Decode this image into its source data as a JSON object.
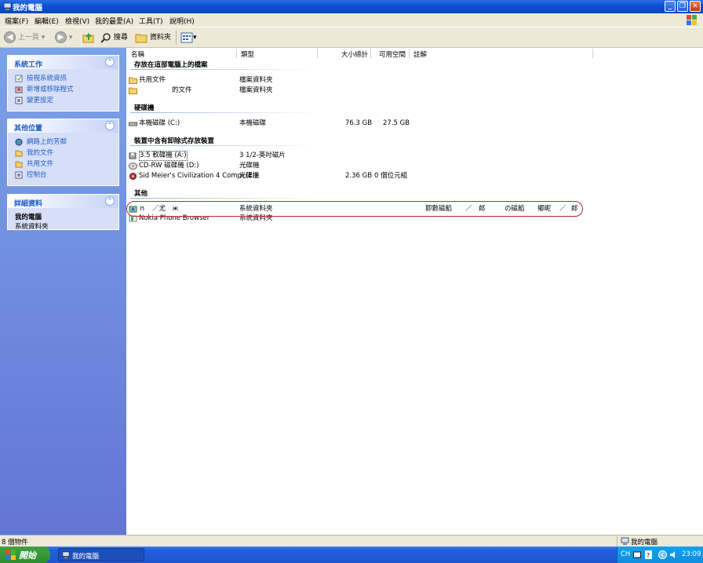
{
  "window": {
    "title": "我的電腦"
  },
  "menu": [
    "檔案(F)",
    "編輯(E)",
    "檢視(V)",
    "我的最愛(A)",
    "工具(T)",
    "說明(H)"
  ],
  "toolbar": {
    "back": "上一頁",
    "search": "搜尋",
    "folders": "資料夾"
  },
  "sidebar": {
    "system_tasks": {
      "title": "系統工作",
      "items": [
        "檢視系統資訊",
        "新增或移除程式",
        "變更設定"
      ]
    },
    "other_places": {
      "title": "其他位置",
      "items": [
        "網路上的芳鄰",
        "我的文件",
        "共用文件",
        "控制台"
      ]
    },
    "details": {
      "title": "詳細資料",
      "name": "我的電腦",
      "type": "系統資料夾"
    }
  },
  "columns": [
    "名稱",
    "類型",
    "大小總計",
    "可用空間",
    "註解"
  ],
  "groups": {
    "stored": "存放在這部電腦上的檔案",
    "hdd": "硬碟機",
    "removable": "裝置中含有卸除式存放裝置",
    "other": "其他"
  },
  "files": [
    {
      "name": "共用文件",
      "type": "檔案資料夾"
    },
    {
      "name": "的文件",
      "type": "檔案資料夾"
    }
  ],
  "hdds": [
    {
      "name": "本機磁碟 (C:)",
      "type": "本機磁碟",
      "total": "76.3 GB",
      "free": "27.5 GB"
    }
  ],
  "removables": [
    {
      "name": "3.5 軟碟機 (A:)",
      "type": "3 1/2-英吋磁片",
      "total": "",
      "free": ""
    },
    {
      "name": "CD-RW 磁碟機 (D:)",
      "type": "光碟機",
      "total": "",
      "free": ""
    },
    {
      "name": "Sid Meier's Civilization 4 Compl (E:)",
      "type": "光碟機",
      "total": "2.36 GB",
      "free": "0 個位元組"
    }
  ],
  "others": [
    {
      "name": "ｎ　／尤　ж",
      "type": "系統資料夾",
      "comment": [
        "即數磁餡",
        "／",
        "郎",
        "の磁餡",
        "鄉昵",
        "／",
        "郎"
      ]
    },
    {
      "name": "Nokia Phone Browser",
      "type": "系統資料夾",
      "comment": []
    }
  ],
  "status": {
    "count": "8 個物件",
    "location": "我的電腦"
  },
  "taskbar": {
    "start": "開始",
    "task": "我的電腦",
    "lang": "CH",
    "time": "23:09"
  },
  "colors": {
    "title": "#0a4fd1",
    "sidebar": "#6f8ce0",
    "link": "#215dc6",
    "highlight": "#c0282e"
  }
}
